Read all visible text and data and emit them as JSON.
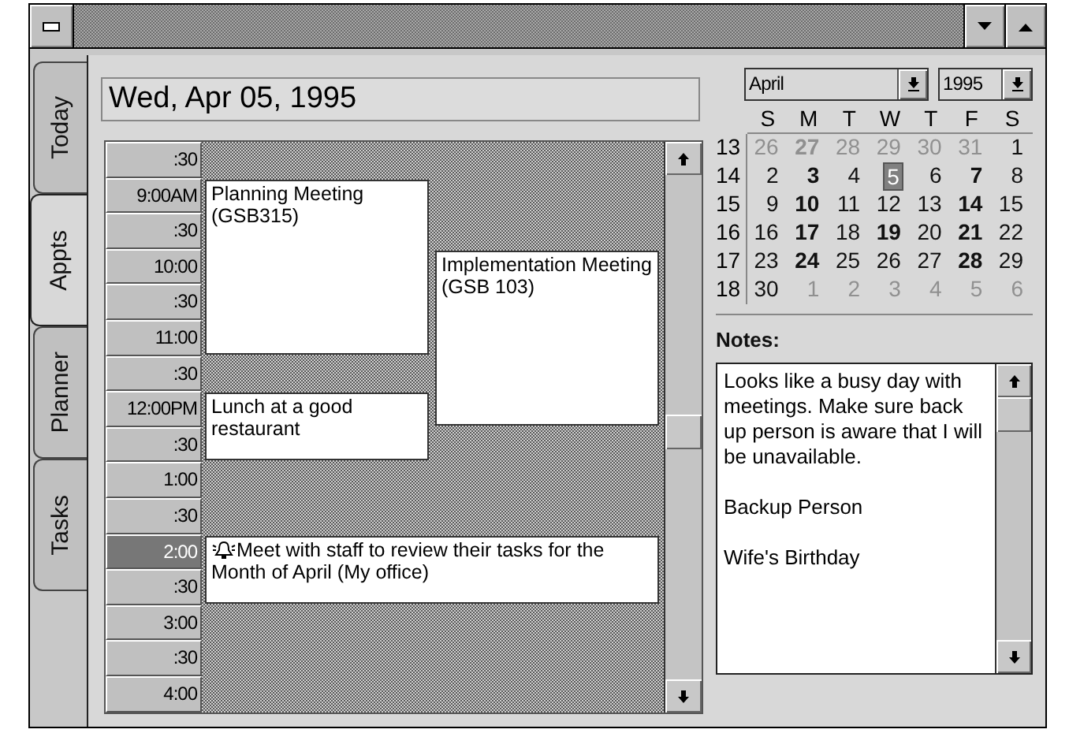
{
  "tabs": [
    {
      "label": "Today",
      "selected": false
    },
    {
      "label": "Appts",
      "selected": true
    },
    {
      "label": "Planner",
      "selected": false
    },
    {
      "label": "Tasks",
      "selected": false
    }
  ],
  "date_field": {
    "value": "Wed, Apr 05, 1995"
  },
  "schedule": {
    "slots": [
      {
        "time": ":30",
        "selected": false
      },
      {
        "time": "9:00AM",
        "selected": false
      },
      {
        "time": ":30",
        "selected": false
      },
      {
        "time": "10:00",
        "selected": false
      },
      {
        "time": ":30",
        "selected": false
      },
      {
        "time": "11:00",
        "selected": false
      },
      {
        "time": ":30",
        "selected": false
      },
      {
        "time": "12:00PM",
        "selected": false
      },
      {
        "time": ":30",
        "selected": false
      },
      {
        "time": "1:00",
        "selected": false
      },
      {
        "time": ":30",
        "selected": false
      },
      {
        "time": "2:00",
        "selected": true
      },
      {
        "time": ":30",
        "selected": false
      },
      {
        "time": "3:00",
        "selected": false
      },
      {
        "time": ":30",
        "selected": false
      },
      {
        "time": "4:00",
        "selected": false
      }
    ],
    "appointments": [
      {
        "text": "Planning Meeting (GSB315)",
        "alarm": false
      },
      {
        "text": "Implementation Meeting  (GSB 103)",
        "alarm": false
      },
      {
        "text": "Lunch at a good restaurant",
        "alarm": false
      },
      {
        "text": "Meet with staff to review their tasks for the Month of April (My office)",
        "alarm": true
      }
    ]
  },
  "calendar": {
    "month": "April",
    "year": "1995",
    "weekdays": [
      "S",
      "M",
      "T",
      "W",
      "T",
      "F",
      "S"
    ],
    "weeks": [
      {
        "number": "13",
        "days": [
          {
            "day": "26",
            "other_month": true,
            "bold": false,
            "selected": false
          },
          {
            "day": "27",
            "other_month": true,
            "bold": true,
            "selected": false
          },
          {
            "day": "28",
            "other_month": true,
            "bold": false,
            "selected": false
          },
          {
            "day": "29",
            "other_month": true,
            "bold": false,
            "selected": false
          },
          {
            "day": "30",
            "other_month": true,
            "bold": false,
            "selected": false
          },
          {
            "day": "31",
            "other_month": true,
            "bold": false,
            "selected": false
          },
          {
            "day": "1",
            "other_month": false,
            "bold": false,
            "selected": false
          }
        ]
      },
      {
        "number": "14",
        "days": [
          {
            "day": "2",
            "other_month": false,
            "bold": false,
            "selected": false
          },
          {
            "day": "3",
            "other_month": false,
            "bold": true,
            "selected": false
          },
          {
            "day": "4",
            "other_month": false,
            "bold": false,
            "selected": false
          },
          {
            "day": "5",
            "other_month": false,
            "bold": false,
            "selected": true
          },
          {
            "day": "6",
            "other_month": false,
            "bold": false,
            "selected": false
          },
          {
            "day": "7",
            "other_month": false,
            "bold": true,
            "selected": false
          },
          {
            "day": "8",
            "other_month": false,
            "bold": false,
            "selected": false
          }
        ]
      },
      {
        "number": "15",
        "days": [
          {
            "day": "9",
            "other_month": false,
            "bold": false,
            "selected": false
          },
          {
            "day": "10",
            "other_month": false,
            "bold": true,
            "selected": false
          },
          {
            "day": "11",
            "other_month": false,
            "bold": false,
            "selected": false
          },
          {
            "day": "12",
            "other_month": false,
            "bold": false,
            "selected": false
          },
          {
            "day": "13",
            "other_month": false,
            "bold": false,
            "selected": false
          },
          {
            "day": "14",
            "other_month": false,
            "bold": true,
            "selected": false
          },
          {
            "day": "15",
            "other_month": false,
            "bold": false,
            "selected": false
          }
        ]
      },
      {
        "number": "16",
        "days": [
          {
            "day": "16",
            "other_month": false,
            "bold": false,
            "selected": false
          },
          {
            "day": "17",
            "other_month": false,
            "bold": true,
            "selected": false
          },
          {
            "day": "18",
            "other_month": false,
            "bold": false,
            "selected": false
          },
          {
            "day": "19",
            "other_month": false,
            "bold": true,
            "selected": false
          },
          {
            "day": "20",
            "other_month": false,
            "bold": false,
            "selected": false
          },
          {
            "day": "21",
            "other_month": false,
            "bold": true,
            "selected": false
          },
          {
            "day": "22",
            "other_month": false,
            "bold": false,
            "selected": false
          }
        ]
      },
      {
        "number": "17",
        "days": [
          {
            "day": "23",
            "other_month": false,
            "bold": false,
            "selected": false
          },
          {
            "day": "24",
            "other_month": false,
            "bold": true,
            "selected": false
          },
          {
            "day": "25",
            "other_month": false,
            "bold": false,
            "selected": false
          },
          {
            "day": "26",
            "other_month": false,
            "bold": false,
            "selected": false
          },
          {
            "day": "27",
            "other_month": false,
            "bold": false,
            "selected": false
          },
          {
            "day": "28",
            "other_month": false,
            "bold": true,
            "selected": false
          },
          {
            "day": "29",
            "other_month": false,
            "bold": false,
            "selected": false
          }
        ]
      },
      {
        "number": "18",
        "days": [
          {
            "day": "30",
            "other_month": false,
            "bold": false,
            "selected": false
          },
          {
            "day": "1",
            "other_month": true,
            "bold": false,
            "selected": false
          },
          {
            "day": "2",
            "other_month": true,
            "bold": false,
            "selected": false
          },
          {
            "day": "3",
            "other_month": true,
            "bold": false,
            "selected": false
          },
          {
            "day": "4",
            "other_month": true,
            "bold": false,
            "selected": false
          },
          {
            "day": "5",
            "other_month": true,
            "bold": false,
            "selected": false
          },
          {
            "day": "6",
            "other_month": true,
            "bold": false,
            "selected": false
          }
        ]
      }
    ]
  },
  "notes": {
    "label": "Notes:",
    "lines": [
      "Looks like a busy day with meetings.  Make sure back up person is aware that I will be unavailable.",
      "Backup Person",
      "Wife's Birthday"
    ]
  }
}
